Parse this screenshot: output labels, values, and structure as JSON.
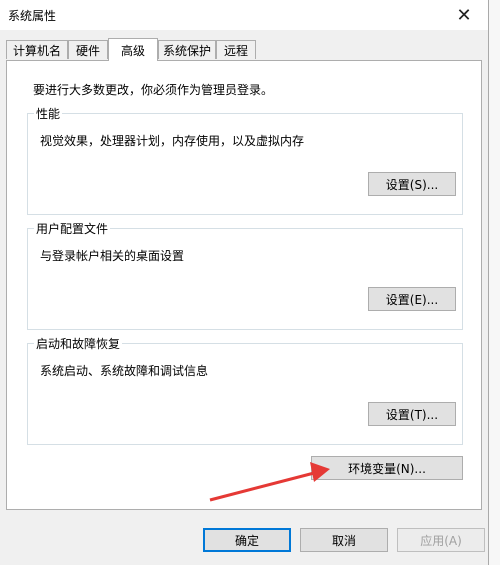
{
  "window": {
    "title": "系统属性",
    "close_glyph": "✕"
  },
  "tabs": [
    {
      "label": "计算机名",
      "active": false
    },
    {
      "label": "硬件",
      "active": false
    },
    {
      "label": "高级",
      "active": true
    },
    {
      "label": "系统保护",
      "active": false
    },
    {
      "label": "远程",
      "active": false
    }
  ],
  "notice": "要进行大多数更改，你必须作为管理员登录。",
  "groups": {
    "performance": {
      "title": "性能",
      "desc": "视觉效果，处理器计划，内存使用，以及虚拟内存",
      "button": "设置(S)..."
    },
    "user_profiles": {
      "title": "用户配置文件",
      "desc": "与登录帐户相关的桌面设置",
      "button": "设置(E)..."
    },
    "startup_recovery": {
      "title": "启动和故障恢复",
      "desc": "系统启动、系统故障和调试信息",
      "button": "设置(T)..."
    }
  },
  "env_button": "环境变量(N)...",
  "footer": {
    "ok": "确定",
    "cancel": "取消",
    "apply": "应用(A)"
  },
  "colors": {
    "accent": "#0078d7",
    "arrow": "#e53935"
  }
}
